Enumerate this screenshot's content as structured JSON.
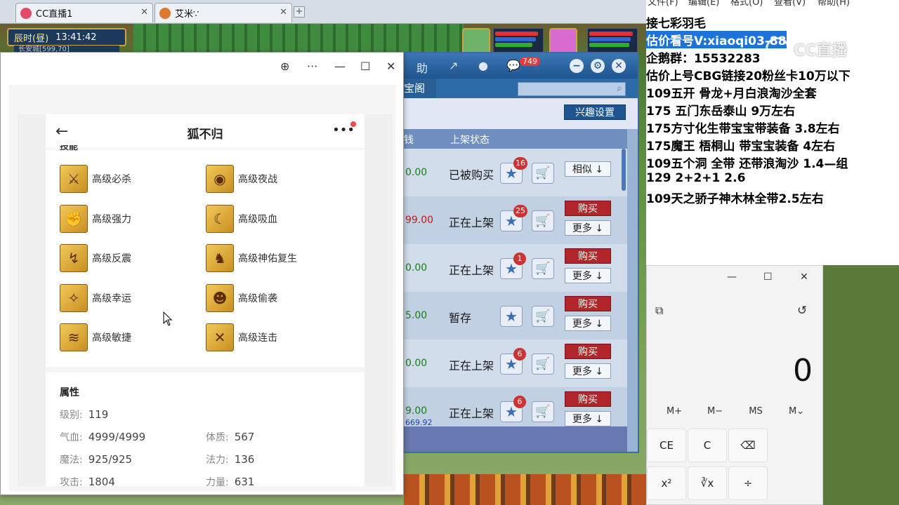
{
  "browser_tabs": [
    {
      "label": "CC直播1",
      "icon_color": "#e24a6a"
    },
    {
      "label": "艾米∵",
      "icon_color": "#e0782a"
    }
  ],
  "game": {
    "time_period": "辰时(昼)",
    "clock": "13:41:42",
    "location": "长安城[599,70]"
  },
  "trade": {
    "badge": "749",
    "tab_label": "宝阁",
    "interest_button": "兴趣设置",
    "col_price": "钱",
    "col_status": "上架状态",
    "rows": [
      {
        "price": "0.00",
        "price_color": "green",
        "price2": "",
        "status": "已被购买",
        "count": "16",
        "buy": "",
        "more": "相似 ↓"
      },
      {
        "price": "99.00",
        "price_color": "red",
        "price2": "",
        "status": "正在上架",
        "count": "25",
        "buy": "购买",
        "more": "更多 ↓"
      },
      {
        "price": "0.00",
        "price_color": "green",
        "price2": "",
        "status": "正在上架",
        "count": "1",
        "buy": "购买",
        "more": "更多 ↓"
      },
      {
        "price": "5.00",
        "price_color": "green",
        "price2": "",
        "status": "暂存",
        "count": "",
        "buy": "购买",
        "more": "更多 ↓"
      },
      {
        "price": "0.00",
        "price_color": "green",
        "price2": "",
        "status": "正在上架",
        "count": "6",
        "buy": "购买",
        "more": "更多 ↓"
      },
      {
        "price": "9.00",
        "price_color": "green",
        "price2": "669.92",
        "status": "正在上架",
        "count": "6",
        "buy": "购买",
        "more": "更多 ↓"
      }
    ]
  },
  "popup": {
    "title": "狐不归",
    "skills_section": "技能",
    "skills": [
      {
        "label": "高级必杀",
        "glyph": "⚔"
      },
      {
        "label": "高级夜战",
        "glyph": "◉"
      },
      {
        "label": "高级强力",
        "glyph": "✊"
      },
      {
        "label": "高级吸血",
        "glyph": "☾"
      },
      {
        "label": "高级反震",
        "glyph": "↯"
      },
      {
        "label": "高级神佑复生",
        "glyph": "♞"
      },
      {
        "label": "高级幸运",
        "glyph": "✧"
      },
      {
        "label": "高级偷袭",
        "glyph": "☻"
      },
      {
        "label": "高级敏捷",
        "glyph": "≋"
      },
      {
        "label": "高级连击",
        "glyph": "✕"
      }
    ],
    "attr_section": "属性",
    "attrs": {
      "level_k": "级别:",
      "level_v": "119",
      "hp_k": "气血:",
      "hp_v": "4999/4999",
      "con_k": "体质:",
      "con_v": "567",
      "mp_k": "魔法:",
      "mp_v": "925/925",
      "mag_k": "法力:",
      "mag_v": "136",
      "atk_k": "攻击:",
      "atk_v": "1804",
      "str_k": "力量:",
      "str_v": "631"
    }
  },
  "notepad": {
    "menu": [
      "文件(F)",
      "编辑(E)",
      "格式(O)",
      "查看(V)",
      "帮助(H)"
    ],
    "lines": [
      "    接七彩羽毛",
      "估价看号V:xiaoqi03-88",
      "企鹅群：15532283",
      "估价上号CBG链接20粉丝卡10万以下",
      "109五开 骨龙+月白浪淘沙全套",
      "175 五门东岳泰山  9万左右",
      "175方寸化生带宝宝带装备  3.8左右",
      "175魔王 梧桐山  带宝宝装备 4左右",
      "109五个洞 全带 还带浪淘沙  1.4—组",
      "129 2+2+1  2.6",
      "109天之骄子神木林全带2.5左右"
    ],
    "watermark": "CC直播"
  },
  "calculator": {
    "display": "0",
    "memory": [
      "M+",
      "M−",
      "MS",
      "M⌄"
    ],
    "keys": [
      "CE",
      "C",
      "⌫",
      "x²",
      "∛x",
      "÷"
    ]
  }
}
